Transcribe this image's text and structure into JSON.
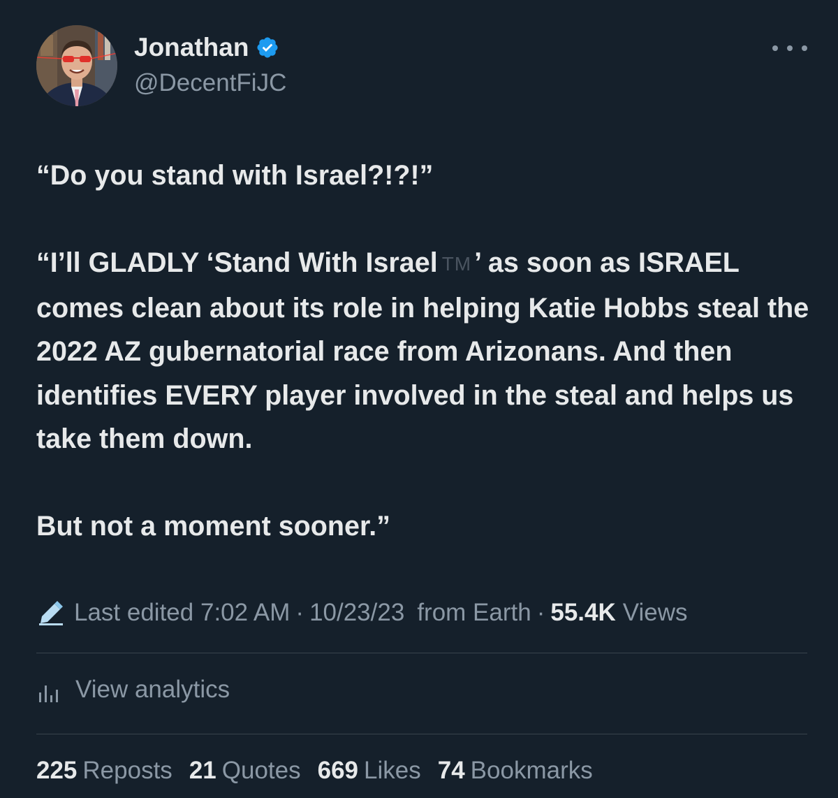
{
  "author": {
    "display_name": "Jonathan",
    "handle": "@DecentFiJC",
    "verified_badge_color": "#1d9bf0"
  },
  "tweet": {
    "line1": "“Do you stand with Israel?!?!”",
    "para2_before_tm": "“I’ll GLADLY ‘Stand With Israel",
    "trademark": "TM",
    "para2_after_tm": "’ as soon as ISRAEL comes clean about its role in helping Katie Hobbs steal the 2022 AZ gubernatorial race from Arizonans. And then identifies EVERY player involved in the steal and helps us take them down.",
    "line3": "But not a moment sooner.”"
  },
  "meta": {
    "edit_icon": "pencil-icon",
    "edited_label": "Last edited",
    "time": "7:02 AM",
    "date": "10/23/23",
    "source": "from Earth",
    "views_count": "55.4K",
    "views_label": "Views",
    "separator": "·"
  },
  "analytics": {
    "icon": "bar-chart-icon",
    "label": "View analytics"
  },
  "stats": {
    "reposts_count": "225",
    "reposts_label": "Reposts",
    "quotes_count": "21",
    "quotes_label": "Quotes",
    "likes_count": "669",
    "likes_label": "Likes",
    "bookmarks_count": "74",
    "bookmarks_label": "Bookmarks"
  },
  "colors": {
    "background": "#15202b",
    "primary_text": "#e7e9ea",
    "secondary_text": "#8b98a5",
    "divider": "#38444d"
  }
}
